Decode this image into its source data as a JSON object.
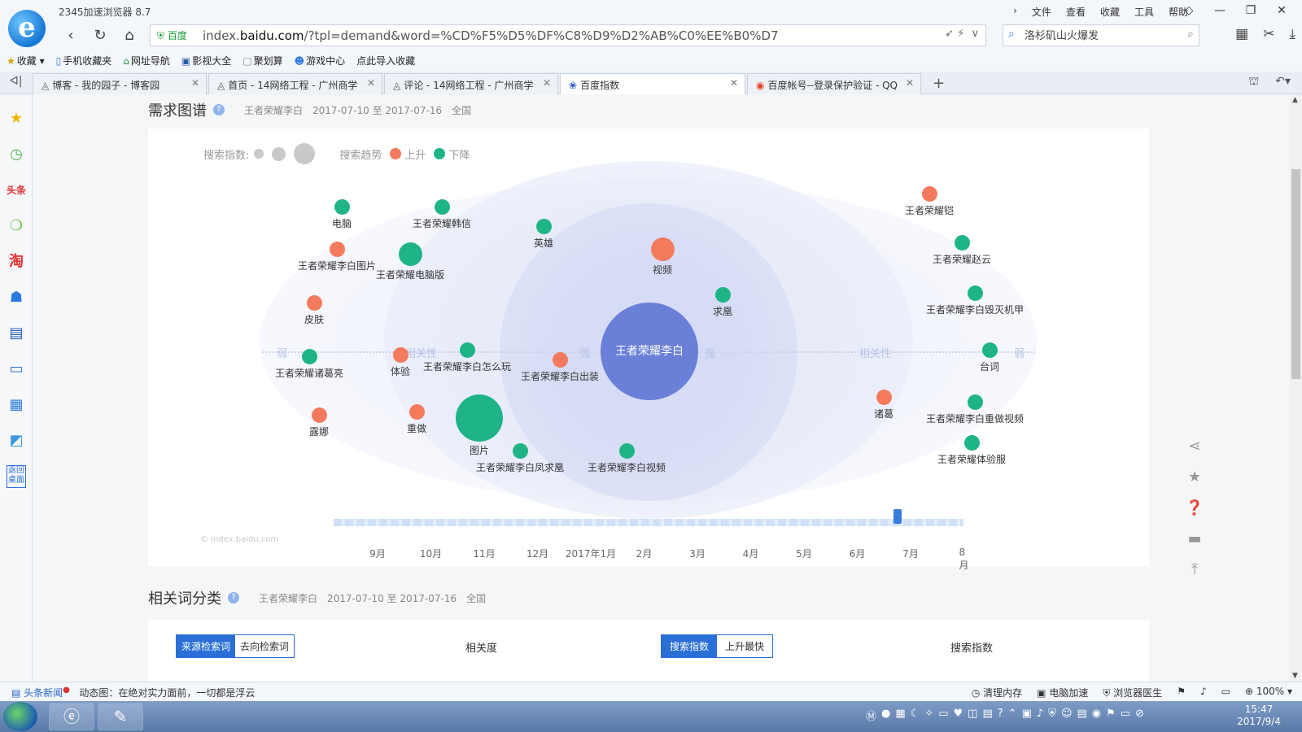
{
  "window": {
    "app_title": "2345加速浏览器 8.7",
    "menu": [
      "文件",
      "查看",
      "收藏",
      "工具",
      "帮助"
    ],
    "controls": [
      "◇",
      "—",
      "❐",
      "✕"
    ]
  },
  "navbar": {
    "secure_label": "百度",
    "url_prefix": "index.",
    "url_domain": "baidu.com",
    "url_rest": "/?tpl=demand&word=%CD%F5%D5%DF%C8%D9%D2%AB%C0%EE%B0%D7",
    "search_value": "洛杉矶山火爆发"
  },
  "bookmarks": [
    "收藏",
    "手机收藏夹",
    "网址导航",
    "影视大全",
    "聚划算",
    "游戏中心",
    "点此导入收藏"
  ],
  "tabs": [
    {
      "label": "博客 - 我的园子 - 博客园",
      "active": false
    },
    {
      "label": "首页 - 14网络工程 - 广州商学",
      "active": false
    },
    {
      "label": "评论 - 14网络工程 - 广州商学",
      "active": false
    },
    {
      "label": "百度指数",
      "active": true
    },
    {
      "label": "百度帐号--登录保护验证 - QQ",
      "active": false
    }
  ],
  "demand": {
    "title": "需求图谱",
    "keyword": "王者荣耀李白",
    "date_range": "2017-07-10 至 2017-07-16",
    "region": "全国",
    "legend_index_label": "搜索指数:",
    "legend_trend_label": "搜索趋势",
    "legend_up": "上升",
    "legend_down": "下降",
    "axis_weak": "弱",
    "axis_relevance": "相关性",
    "axis_strong": "强",
    "center_label": "王者荣耀李白",
    "watermark": "© index.baidu.com",
    "colors": {
      "up": "#f47a5e",
      "down": "#1fb487",
      "center": "#6a7fd8"
    },
    "timeline_months": [
      "9月",
      "10月",
      "11月",
      "12月",
      "2017年1月",
      "2月",
      "3月",
      "4月",
      "5月",
      "6月",
      "7月",
      "8月"
    ],
    "timeline_selected": "7月",
    "bubbles": [
      {
        "label": "电脑",
        "trend": "down",
        "index": "small"
      },
      {
        "label": "王者荣耀韩信",
        "trend": "down",
        "index": "small"
      },
      {
        "label": "英雄",
        "trend": "down",
        "index": "small"
      },
      {
        "label": "视频",
        "trend": "up",
        "index": "medium"
      },
      {
        "label": "王者荣耀铠",
        "trend": "up",
        "index": "small"
      },
      {
        "label": "王者荣耀李白图片",
        "trend": "up",
        "index": "small"
      },
      {
        "label": "王者荣耀电脑版",
        "trend": "down",
        "index": "medium"
      },
      {
        "label": "王者荣耀赵云",
        "trend": "down",
        "index": "small"
      },
      {
        "label": "求凰",
        "trend": "down",
        "index": "small"
      },
      {
        "label": "王者荣耀李白毁灭机甲",
        "trend": "down",
        "index": "small"
      },
      {
        "label": "皮肤",
        "trend": "up",
        "index": "small"
      },
      {
        "label": "王者荣耀诸葛亮",
        "trend": "down",
        "index": "small"
      },
      {
        "label": "体验",
        "trend": "up",
        "index": "small"
      },
      {
        "label": "王者荣耀李白怎么玩",
        "trend": "down",
        "index": "small"
      },
      {
        "label": "王者荣耀李白出装",
        "trend": "up",
        "index": "small"
      },
      {
        "label": "台词",
        "trend": "down",
        "index": "small"
      },
      {
        "label": "诸葛",
        "trend": "up",
        "index": "small"
      },
      {
        "label": "露娜",
        "trend": "up",
        "index": "small"
      },
      {
        "label": "重做",
        "trend": "up",
        "index": "small"
      },
      {
        "label": "图片",
        "trend": "down",
        "index": "large"
      },
      {
        "label": "王者荣耀李白重做视频",
        "trend": "down",
        "index": "small"
      },
      {
        "label": "王者荣耀李白凤求凰",
        "trend": "down",
        "index": "small"
      },
      {
        "label": "王者荣耀李白视频",
        "trend": "down",
        "index": "small"
      },
      {
        "label": "王者荣耀体验服",
        "trend": "down",
        "index": "small"
      }
    ]
  },
  "related": {
    "title": "相关词分类",
    "keyword": "王者荣耀李白",
    "date_range": "2017-07-10 至 2017-07-16",
    "region": "全国",
    "left_tabs": [
      "来源检索词",
      "去向检索词"
    ],
    "left_header": "相关度",
    "right_tabs": [
      "搜索指数",
      "上升最快"
    ],
    "right_header": "搜索指数"
  },
  "statusbar": {
    "news": "头条新闻",
    "ticker": "动态图：在绝对实力面前，一切都是浮云",
    "items": [
      "清理内存",
      "电脑加速",
      "浏览器医生",
      "100%"
    ]
  },
  "taskbar": {
    "time": "15:47",
    "date": "2017/9/4"
  }
}
